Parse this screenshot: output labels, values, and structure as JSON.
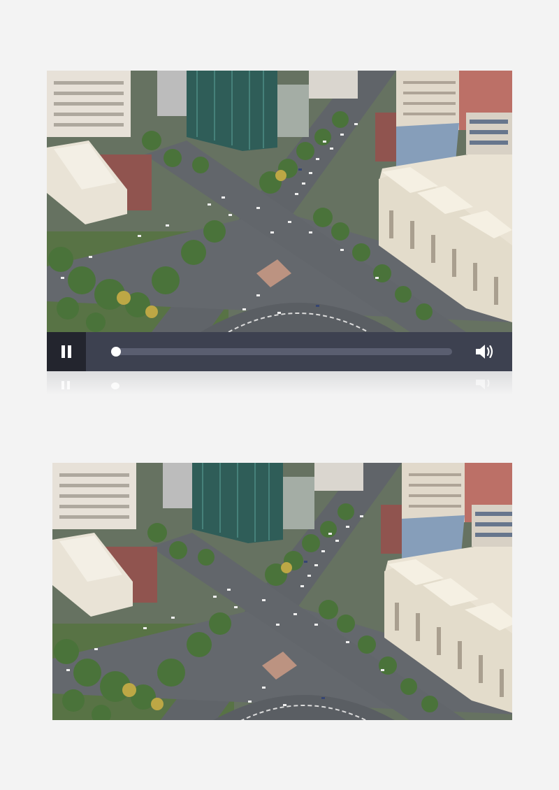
{
  "player": {
    "state": "playing",
    "progress_fraction": 0.0,
    "pause_icon": "pause-icon",
    "volume_icon": "volume-icon"
  },
  "colors": {
    "page_background": "#f3f3f3",
    "control_bar": "#3d4150",
    "pause_button_bg": "#23252e",
    "progress_track": "#5a5e70",
    "thumb": "#ffffff"
  },
  "frames": [
    {
      "name": "video-frame-1",
      "subject": "aerial-city-intersection"
    },
    {
      "name": "video-frame-2",
      "subject": "aerial-city-intersection"
    }
  ]
}
